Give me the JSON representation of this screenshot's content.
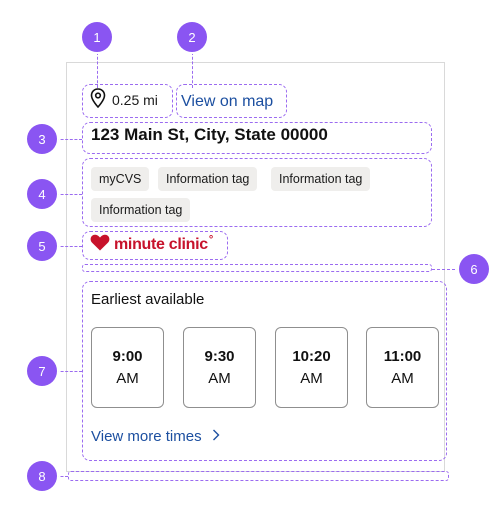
{
  "badges": [
    "1",
    "2",
    "3",
    "4",
    "5",
    "6",
    "7",
    "8"
  ],
  "location": {
    "distance": "0.25 mi",
    "map_link": "View on map",
    "address": "123 Main St, City, State 00000"
  },
  "tags": [
    "myCVS",
    "Information tag",
    "Information tag",
    "Information tag"
  ],
  "brand": {
    "logo_text": "minute clinic",
    "logo_symbol": "°",
    "icon": "heart-icon",
    "color": "#c7122b"
  },
  "availability": {
    "title": "Earliest available",
    "slots": [
      {
        "time": "9:00",
        "ampm": "AM"
      },
      {
        "time": "9:30",
        "ampm": "AM"
      },
      {
        "time": "10:20",
        "ampm": "AM"
      },
      {
        "time": "11:00",
        "ampm": "AM"
      }
    ],
    "more_link": "View more times"
  },
  "colors": {
    "link": "#1c4fa0",
    "annotation": "#8a55f2",
    "tag_bg": "#efeeec"
  }
}
